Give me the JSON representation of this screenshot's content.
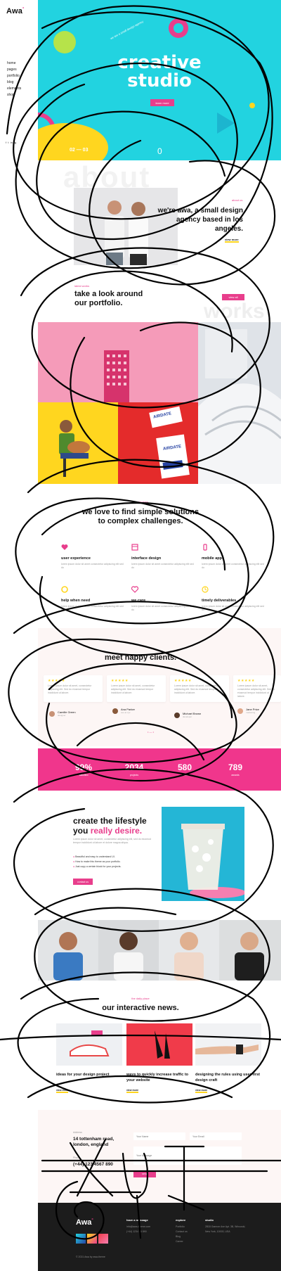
{
  "brand": {
    "logo": "Awa",
    "logo_mark": "°",
    "accent": "#e83e8c",
    "cyan": "#22d3e0",
    "yellow": "#ffd61f"
  },
  "sidebar": {
    "nav": [
      "home",
      "pages",
      "portfolio",
      "blog",
      "elements",
      "shop"
    ],
    "social": [
      "f",
      "t",
      "in",
      "ig"
    ]
  },
  "hero": {
    "title_line1": "creative",
    "title_line2": "studio",
    "subtitle": "we are a small design agency",
    "button": "learn more",
    "slide_counter": "02 — 03",
    "slide_index": "0"
  },
  "about": {
    "watermark": "about",
    "kicker": "about us",
    "headline": "we're awa, a small design agency based in los angeles.",
    "link": "view more"
  },
  "portfolio": {
    "kicker": "latest works",
    "headline_line1": "take a look around",
    "headline_line2": "our portfolio.",
    "watermark": "works",
    "button": "view all",
    "tag_text_1": "AIRDATE",
    "tag_text_2": "AIRDATE"
  },
  "services": {
    "kicker": "our services",
    "headline_line1": "we love to find simple solutions",
    "headline_line2": "to complex challenges.",
    "items": [
      {
        "title": "user experience",
        "desc": "lorem ipsum dolor sit amet consectetur adipiscing elit sed do",
        "icon": "heart-icon"
      },
      {
        "title": "interface design",
        "desc": "lorem ipsum dolor sit amet consectetur adipiscing elit sed do",
        "icon": "layout-icon"
      },
      {
        "title": "mobile apps",
        "desc": "lorem ipsum dolor sit amet consectetur adipiscing elit sed do",
        "icon": "phone-icon"
      },
      {
        "title": "help when need",
        "desc": "lorem ipsum dolor sit amet consectetur adipiscing elit sed do",
        "icon": "lifebuoy-icon"
      },
      {
        "title": "we care",
        "desc": "lorem ipsum dolor sit amet consectetur adipiscing elit sed do",
        "icon": "care-icon"
      },
      {
        "title": "timely deliverables",
        "desc": "lorem ipsum dolor sit amet consectetur adipiscing elit sed do",
        "icon": "clock-icon"
      }
    ]
  },
  "testimonials": {
    "headline": "meet happy clients.",
    "cards": [
      {
        "stars": "★★★★★",
        "text": "Lorem ipsum dolor sit amet, consectetur adipiscing elit. Sed do eiusmod tempor incididunt ut labore.",
        "name": "Camille Green",
        "role": "designer"
      },
      {
        "stars": "★★★★★",
        "text": "Lorem ipsum dolor sit amet, consectetur adipiscing elit. Sed do eiusmod tempor incididunt ut labore.",
        "name": "Ana Parker",
        "role": "ceo at xyz"
      },
      {
        "stars": "★★★★★",
        "text": "Lorem ipsum dolor sit amet, consectetur adipiscing elit. Sed do eiusmod tempor incididunt ut labore.",
        "name": "Michael Brown",
        "role": "developer"
      },
      {
        "stars": "★★★★★",
        "text": "Lorem ipsum dolor sit amet, consectetur adipiscing elit. Sed do eiusmod tempor incididunt ut labore.",
        "name": "Jane Price",
        "role": "marketing"
      }
    ],
    "pager": "• — •"
  },
  "stats": [
    {
      "num": "99%",
      "label": "satisfied"
    },
    {
      "num": "2034",
      "label": "projects"
    },
    {
      "num": "580",
      "label": "clients"
    },
    {
      "num": "789",
      "label": "awards"
    }
  ],
  "lifestyle": {
    "headline_line1": "create the lifestyle",
    "headline_plain": "you",
    "headline_accent": "really desire.",
    "text": "Lorem ipsum dolor sit amet, consectetur adipiscing elit, sed do eiusmod tempor incididunt ut labore et dolore magna aliqua.",
    "list": [
      "Beautiful and easy to understand UI.",
      "How to make this theme as your portfolio.",
      "Just copy a certain block for your projects."
    ],
    "button": "contact us"
  },
  "team": {
    "members": [
      "team-member-1",
      "team-member-2",
      "team-member-3",
      "team-member-4"
    ]
  },
  "news": {
    "kicker": "the daily place",
    "headline": "our interactive news.",
    "items": [
      {
        "title": "ideas for your design project",
        "link": "view more"
      },
      {
        "title": "ways to quickly increase traffic to your website",
        "link": "view more"
      },
      {
        "title": "designing the rules using user-first design craft",
        "link": "view more"
      }
    ]
  },
  "contact": {
    "address_label": "Address",
    "address": "14 tottenham road, london, england",
    "phone_label": "Phone",
    "phone": "(+44) 123 4567 890",
    "name_placeholder": "Your Name",
    "email_placeholder": "Your Email",
    "message_placeholder": "Your Message",
    "button": "send"
  },
  "footer": {
    "logo": "Awa",
    "col1_title": "have a message",
    "col1_lines": [
      "info@awa-theme.com",
      "(+44) 1234 56 890"
    ],
    "col2_title": "explore",
    "col2_lines": [
      "Portfolio",
      "Contact us",
      "Blog",
      "Career"
    ],
    "col3_title": "studio",
    "col3_lines": [
      "2818 Gannon Ave Apt. 3B, Winooski,",
      "New York, 10003, USA"
    ],
    "copyright": "© 2021 Awa by awa-theme"
  }
}
